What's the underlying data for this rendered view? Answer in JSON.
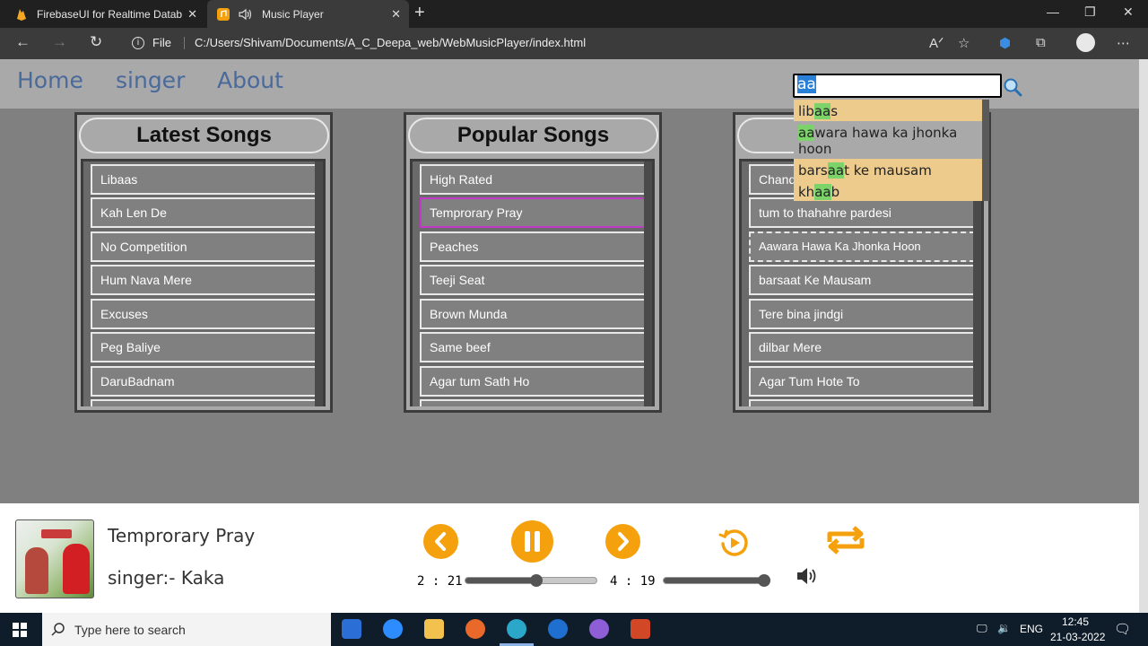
{
  "browser": {
    "tabs": [
      {
        "label": "FirebaseUI for Realtime Database",
        "icon": "firebase-icon"
      },
      {
        "label": "Music Player",
        "icon": "music-icon"
      }
    ],
    "url_scheme": "File",
    "url": "C:/Users/Shivam/Documents/A_C_Deepa_web/WebMusicPlayer/index.html"
  },
  "nav": {
    "links": [
      "Home",
      "singer",
      "About"
    ]
  },
  "search": {
    "value": "aa",
    "suggestions": [
      {
        "pre": "lib",
        "match": "aa",
        "post": "s",
        "highlighted": false
      },
      {
        "pre": "",
        "match": "aa",
        "post": "wara hawa ka jhonka hoon",
        "highlighted": true
      },
      {
        "pre": "bars",
        "match": "aa",
        "post": "t ke mausam",
        "highlighted": false
      },
      {
        "pre": "kh",
        "match": "aa",
        "post": "b",
        "highlighted": false
      }
    ]
  },
  "panels": [
    {
      "title": "Latest Songs",
      "songs": [
        "Libaas",
        "Kah Len De",
        "No Competition",
        "Hum Nava Mere",
        "Excuses",
        "Peg Baliye",
        "DaruBadnam"
      ]
    },
    {
      "title": "Popular Songs",
      "songs": [
        "High Rated",
        "Temprorary Pray",
        "Peaches",
        "Teeji Seat",
        "Brown Munda",
        "Same beef",
        "Agar tum Sath Ho"
      ]
    },
    {
      "title": "",
      "songs": [
        "Chand",
        "tum to thahahre pardesi",
        "Aawara Hawa Ka Jhonka Hoon",
        "barsaat Ke Mausam",
        "Tere bina jindgi",
        "dilbar Mere",
        "Agar Tum Hote To"
      ]
    }
  ],
  "player": {
    "title": "Temprorary Pray",
    "singer": "singer:-  Kaka",
    "current_time": "2 : 21",
    "duration": "4 : 19",
    "progress": 0.54,
    "volume": 0.95
  },
  "taskbar": {
    "search_placeholder": "Type here to search",
    "language": "ENG",
    "time": "12:45",
    "date": "21-03-2022"
  }
}
